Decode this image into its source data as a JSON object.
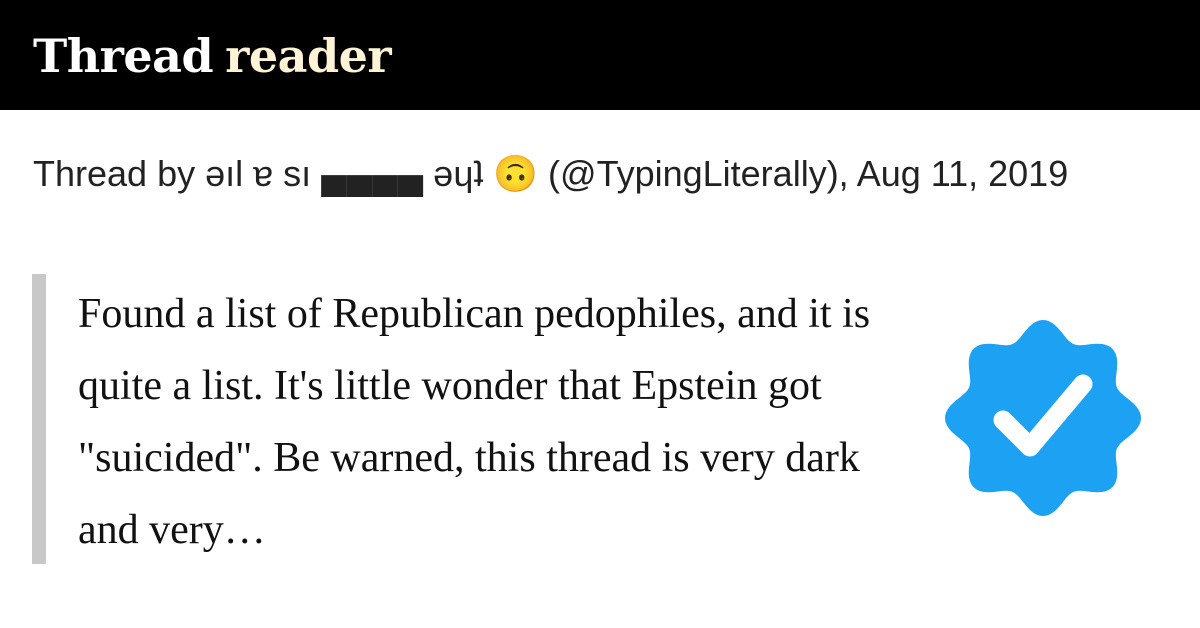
{
  "header": {
    "logo_word_1": "Thread",
    "logo_word_2": "reader",
    "background_color": "#000000",
    "accent_color": "#fff3d6"
  },
  "byline": {
    "text": "Thread by əıl ɐ sı ▄▄▄▄ əɥʇ 🙃 (@TypingLiterally), Aug 11, 2019"
  },
  "tweet": {
    "excerpt": "Found a list of Republican pedophiles, and it is quite a list. It's little wonder that Epstein got \"suicided\". Be warned, this thread is very dark and very…"
  },
  "badge": {
    "icon": "verified-check-icon",
    "color": "#1da1f2"
  }
}
